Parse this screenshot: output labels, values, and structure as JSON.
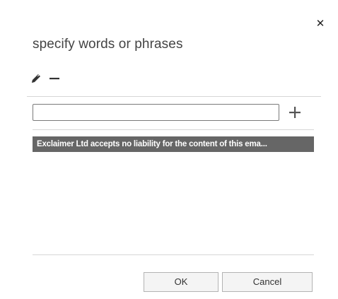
{
  "dialog": {
    "title": "specify words or phrases",
    "close_icon": "close-icon"
  },
  "toolbar": {
    "edit_icon": "pencil-icon",
    "remove_icon": "minus-icon"
  },
  "input": {
    "value": "",
    "placeholder": "",
    "add_icon": "plus-icon"
  },
  "phrases": [
    {
      "text": "Exclaimer Ltd accepts no liability for the content of this ema..."
    }
  ],
  "buttons": {
    "ok_label": "OK",
    "cancel_label": "Cancel"
  },
  "colors": {
    "selected_item_bg": "#666666",
    "selected_item_text": "#ffffff",
    "divider": "#d6d6d6",
    "button_bg": "#f4f4f4"
  }
}
